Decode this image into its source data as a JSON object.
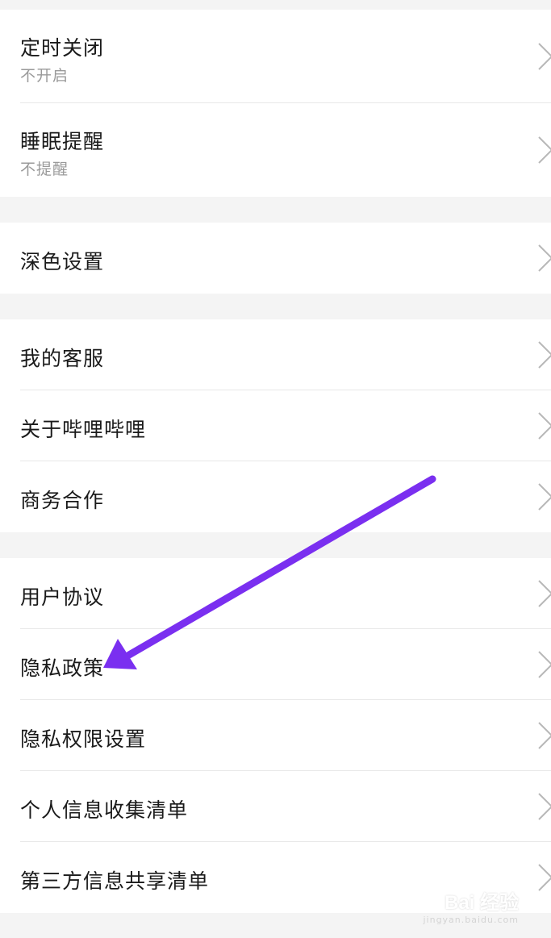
{
  "groups": [
    {
      "items": [
        {
          "title": "定时关闭",
          "subtitle": "不开启"
        },
        {
          "title": "睡眠提醒",
          "subtitle": "不提醒"
        }
      ]
    },
    {
      "items": [
        {
          "title": "深色设置"
        }
      ]
    },
    {
      "items": [
        {
          "title": "我的客服"
        },
        {
          "title": "关于哔哩哔哩"
        },
        {
          "title": "商务合作"
        }
      ]
    },
    {
      "items": [
        {
          "title": "用户协议"
        },
        {
          "title": "隐私政策"
        },
        {
          "title": "隐私权限设置"
        },
        {
          "title": "个人信息收集清单"
        },
        {
          "title": "第三方信息共享清单"
        }
      ]
    }
  ],
  "annotation": {
    "color": "#7a2ff0",
    "points_to": "隐私政策"
  },
  "watermark": {
    "brand": "Bai 经验",
    "url": "jingyan.baidu.com"
  },
  "icons": {
    "row_chevron": "chevron-right-icon",
    "annotation": "arrow-icon"
  }
}
